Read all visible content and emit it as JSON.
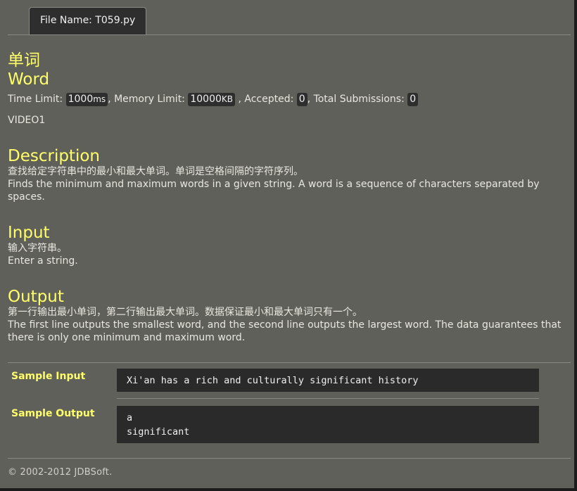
{
  "tab": {
    "label": "File Name:  T059.py"
  },
  "problem": {
    "title_cn": "单词",
    "title_en": "Word",
    "time_limit_label": "Time Limit: ",
    "time_limit_value": "1000",
    "time_limit_unit": "ms",
    "memory_limit_label": ", Memory Limit: ",
    "memory_limit_value": "10000",
    "memory_limit_unit": "KB",
    "accepted_label": " , Accepted: ",
    "accepted_value": "0",
    "submissions_label": ", Total Submissions: ",
    "submissions_value": "0",
    "source": "VIDEO1"
  },
  "description": {
    "heading": "Description",
    "cn": "查找给定字符串中的最小和最大单词。单词是空格间隔的字符序列。",
    "en": "Finds the minimum and maximum words in a given string. A word is a sequence of characters separated by spaces."
  },
  "input": {
    "heading": "Input",
    "cn": "输入字符串。",
    "en": "Enter a string."
  },
  "output": {
    "heading": "Output",
    "cn": "第一行输出最小单词，第二行输出最大单词。数据保证最小和最大单词只有一个。",
    "en": "The first line outputs the smallest word, and the second line outputs the largest word. The data guarantees that there is only one minimum and maximum word."
  },
  "samples": {
    "input_label": "Sample Input",
    "input_value": "Xi'an has a rich and culturally significant history",
    "output_label": "Sample Output",
    "output_value": "a\nsignificant"
  },
  "footer": {
    "text": "© 2002-2012  JDBSoft."
  }
}
